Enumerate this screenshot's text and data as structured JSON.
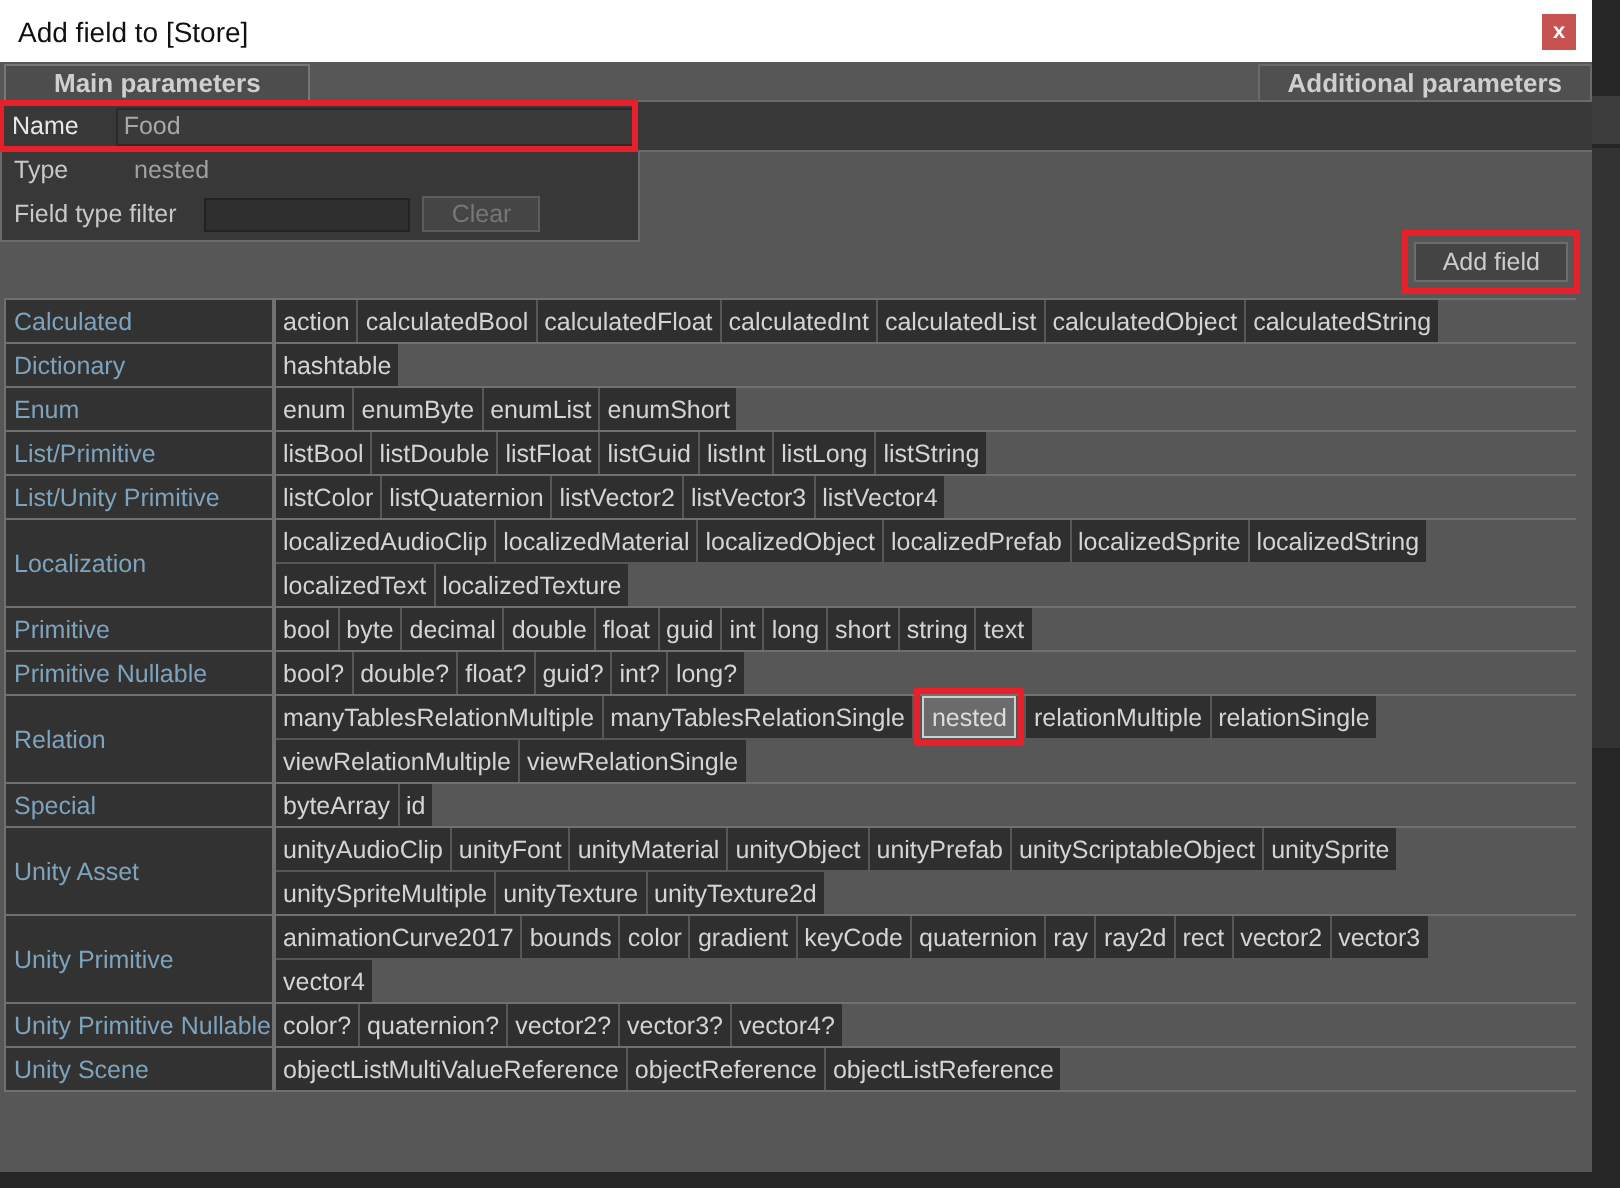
{
  "window": {
    "title": "Add field to [Store]",
    "close": "x"
  },
  "tabs": [
    {
      "label": "Main parameters",
      "selected": true
    },
    {
      "label": "Additional parameters",
      "selected": false
    }
  ],
  "name": {
    "label": "Name",
    "value": "Food",
    "highlighted": true
  },
  "type": {
    "label": "Type",
    "value": "nested"
  },
  "filter": {
    "label": "Field type filter",
    "button": "Clear",
    "disabled": true
  },
  "add_button": {
    "label": "Add field",
    "highlighted": true
  },
  "categories": [
    {
      "name": "Calculated",
      "lines": [
        [
          {
            "label": "action",
            "selected": false
          },
          {
            "label": "calculatedBool",
            "selected": false
          },
          {
            "label": "calculatedFloat",
            "selected": false
          },
          {
            "label": "calculatedInt",
            "selected": false
          },
          {
            "label": "calculatedList",
            "selected": false
          },
          {
            "label": "calculatedObject",
            "selected": false
          },
          {
            "label": "calculatedString",
            "selected": false
          }
        ]
      ]
    },
    {
      "name": "Dictionary",
      "lines": [
        [
          {
            "label": "hashtable",
            "selected": false
          }
        ]
      ]
    },
    {
      "name": "Enum",
      "lines": [
        [
          {
            "label": "enum",
            "selected": false
          },
          {
            "label": "enumByte",
            "selected": false
          },
          {
            "label": "enumList",
            "selected": false
          },
          {
            "label": "enumShort",
            "selected": false
          }
        ]
      ]
    },
    {
      "name": "List/Primitive",
      "lines": [
        [
          {
            "label": "listBool",
            "selected": false
          },
          {
            "label": "listDouble",
            "selected": false
          },
          {
            "label": "listFloat",
            "selected": false
          },
          {
            "label": "listGuid",
            "selected": false
          },
          {
            "label": "listInt",
            "selected": false
          },
          {
            "label": "listLong",
            "selected": false
          },
          {
            "label": "listString",
            "selected": false
          }
        ]
      ]
    },
    {
      "name": "List/Unity Primitive",
      "lines": [
        [
          {
            "label": "listColor",
            "selected": false
          },
          {
            "label": "listQuaternion",
            "selected": false
          },
          {
            "label": "listVector2",
            "selected": false
          },
          {
            "label": "listVector3",
            "selected": false
          },
          {
            "label": "listVector4",
            "selected": false
          }
        ]
      ]
    },
    {
      "name": "Localization",
      "lines": [
        [
          {
            "label": "localizedAudioClip",
            "selected": false
          },
          {
            "label": "localizedMaterial",
            "selected": false
          },
          {
            "label": "localizedObject",
            "selected": false
          },
          {
            "label": "localizedPrefab",
            "selected": false
          },
          {
            "label": "localizedSprite",
            "selected": false
          },
          {
            "label": "localizedString",
            "selected": false
          }
        ],
        [
          {
            "label": "localizedText",
            "selected": false
          },
          {
            "label": "localizedTexture",
            "selected": false
          }
        ]
      ]
    },
    {
      "name": "Primitive",
      "lines": [
        [
          {
            "label": "bool",
            "selected": false
          },
          {
            "label": "byte",
            "selected": false
          },
          {
            "label": "decimal",
            "selected": false
          },
          {
            "label": "double",
            "selected": false
          },
          {
            "label": "float",
            "selected": false
          },
          {
            "label": "guid",
            "selected": false
          },
          {
            "label": "int",
            "selected": false
          },
          {
            "label": "long",
            "selected": false
          },
          {
            "label": "short",
            "selected": false
          },
          {
            "label": "string",
            "selected": false
          },
          {
            "label": "text",
            "selected": false
          }
        ]
      ]
    },
    {
      "name": "Primitive Nullable",
      "lines": [
        [
          {
            "label": "bool?",
            "selected": false
          },
          {
            "label": "double?",
            "selected": false
          },
          {
            "label": "float?",
            "selected": false
          },
          {
            "label": "guid?",
            "selected": false
          },
          {
            "label": "int?",
            "selected": false
          },
          {
            "label": "long?",
            "selected": false
          }
        ]
      ]
    },
    {
      "name": "Relation",
      "lines": [
        [
          {
            "label": "manyTablesRelationMultiple",
            "selected": false
          },
          {
            "label": "manyTablesRelationSingle",
            "selected": false
          },
          {
            "label": "nested",
            "selected": true
          },
          {
            "label": "relationMultiple",
            "selected": false
          },
          {
            "label": "relationSingle",
            "selected": false
          }
        ],
        [
          {
            "label": "viewRelationMultiple",
            "selected": false
          },
          {
            "label": "viewRelationSingle",
            "selected": false
          }
        ]
      ]
    },
    {
      "name": "Special",
      "lines": [
        [
          {
            "label": "byteArray",
            "selected": false
          },
          {
            "label": "id",
            "selected": false
          }
        ]
      ]
    },
    {
      "name": "Unity Asset",
      "lines": [
        [
          {
            "label": "unityAudioClip",
            "selected": false
          },
          {
            "label": "unityFont",
            "selected": false
          },
          {
            "label": "unityMaterial",
            "selected": false
          },
          {
            "label": "unityObject",
            "selected": false
          },
          {
            "label": "unityPrefab",
            "selected": false
          },
          {
            "label": "unityScriptableObject",
            "selected": false
          },
          {
            "label": "unitySprite",
            "selected": false
          }
        ],
        [
          {
            "label": "unitySpriteMultiple",
            "selected": false
          },
          {
            "label": "unityTexture",
            "selected": false
          },
          {
            "label": "unityTexture2d",
            "selected": false
          }
        ]
      ]
    },
    {
      "name": "Unity Primitive",
      "lines": [
        [
          {
            "label": "animationCurve2017",
            "selected": false
          },
          {
            "label": "bounds",
            "selected": false
          },
          {
            "label": "color",
            "selected": false
          },
          {
            "label": "gradient",
            "selected": false
          },
          {
            "label": "keyCode",
            "selected": false
          },
          {
            "label": "quaternion",
            "selected": false
          },
          {
            "label": "ray",
            "selected": false
          },
          {
            "label": "ray2d",
            "selected": false
          },
          {
            "label": "rect",
            "selected": false
          },
          {
            "label": "vector2",
            "selected": false
          },
          {
            "label": "vector3",
            "selected": false
          }
        ],
        [
          {
            "label": "vector4",
            "selected": false
          }
        ]
      ]
    },
    {
      "name": "Unity Primitive Nullable",
      "lines": [
        [
          {
            "label": "color?",
            "selected": false
          },
          {
            "label": "quaternion?",
            "selected": false
          },
          {
            "label": "vector2?",
            "selected": false
          },
          {
            "label": "vector3?",
            "selected": false
          },
          {
            "label": "vector4?",
            "selected": false
          }
        ]
      ]
    },
    {
      "name": "Unity Scene",
      "lines": [
        [
          {
            "label": "objectListMultiValueReference",
            "selected": false
          },
          {
            "label": "objectReference",
            "selected": false
          },
          {
            "label": "objectListReference",
            "selected": false
          }
        ]
      ]
    }
  ]
}
